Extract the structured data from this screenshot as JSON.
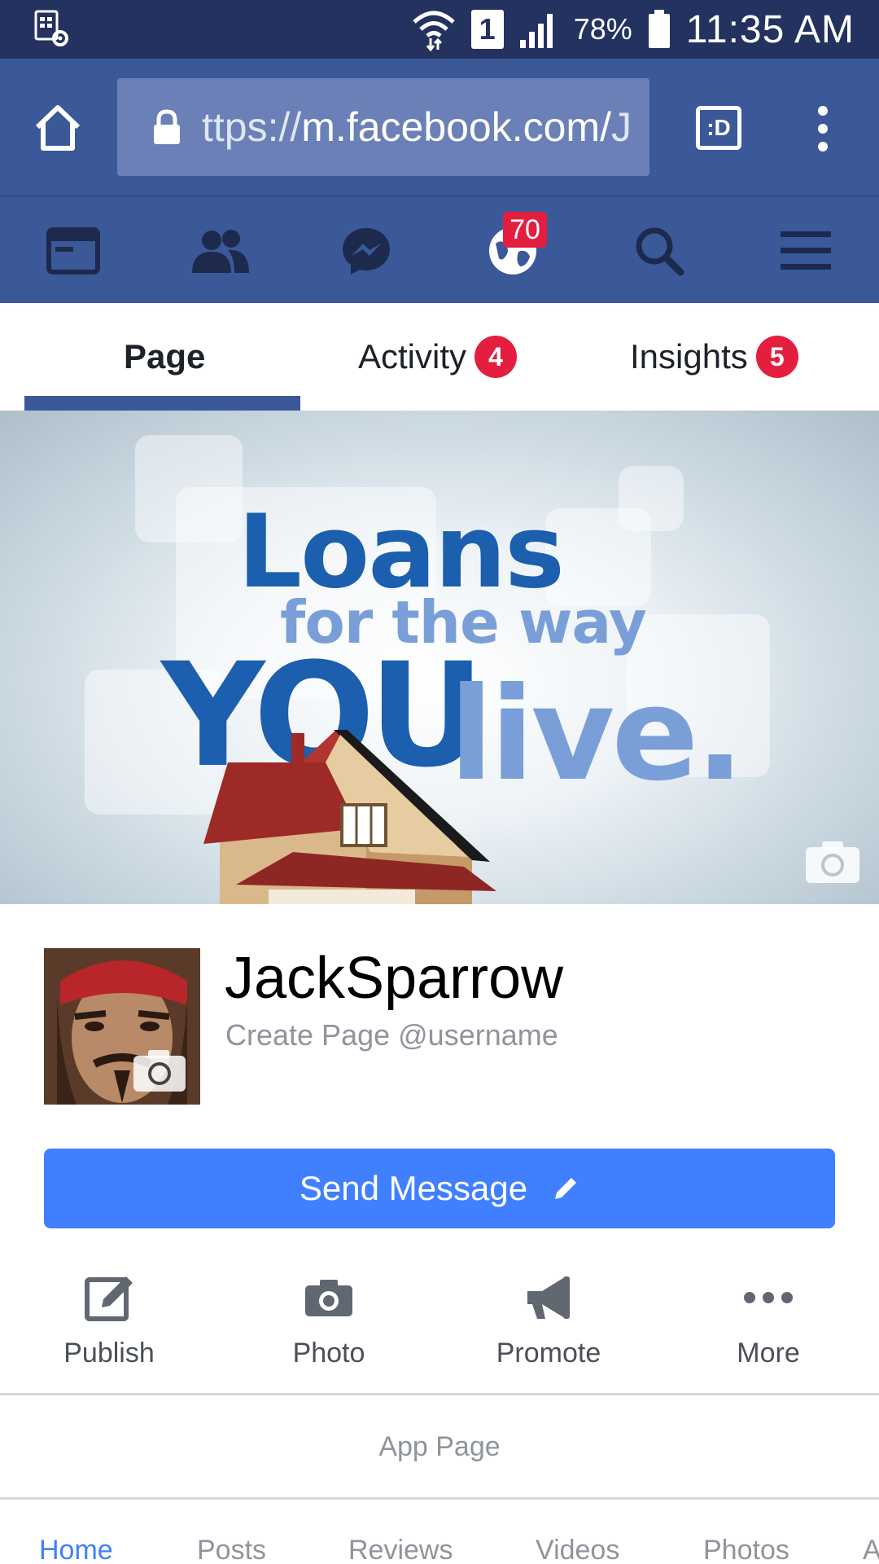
{
  "status_bar": {
    "battery": "78%",
    "sim": "1",
    "time": "11:35 AM"
  },
  "browser": {
    "url_prefix": "ttps://",
    "url_host": "m.facebook.com/",
    "url_tail": "J",
    "tabs_label": ":D"
  },
  "fb_nav": {
    "notifications_count": "70"
  },
  "page_tabs": [
    {
      "label": "Page"
    },
    {
      "label": "Activity",
      "count": "4"
    },
    {
      "label": "Insights",
      "count": "5"
    }
  ],
  "cover": {
    "line1": "Loans",
    "line2": "for the way",
    "line3a": "YOU",
    "line3b": "live."
  },
  "profile": {
    "name": "JackSparrow",
    "handle": "Create Page @username"
  },
  "send_message": {
    "label": "Send Message"
  },
  "actions": [
    {
      "label": "Publish"
    },
    {
      "label": "Photo"
    },
    {
      "label": "Promote"
    },
    {
      "label": "More"
    }
  ],
  "app_page": {
    "label": "App Page"
  },
  "sub_tabs": [
    {
      "label": "Home"
    },
    {
      "label": "Posts"
    },
    {
      "label": "Reviews"
    },
    {
      "label": "Videos"
    },
    {
      "label": "Photos"
    },
    {
      "label": "A"
    }
  ],
  "colors": {
    "status_bar": "#23325e",
    "brand_blue": "#3b5998",
    "button_blue": "#4080ff",
    "badge_red": "#e41e3f"
  }
}
